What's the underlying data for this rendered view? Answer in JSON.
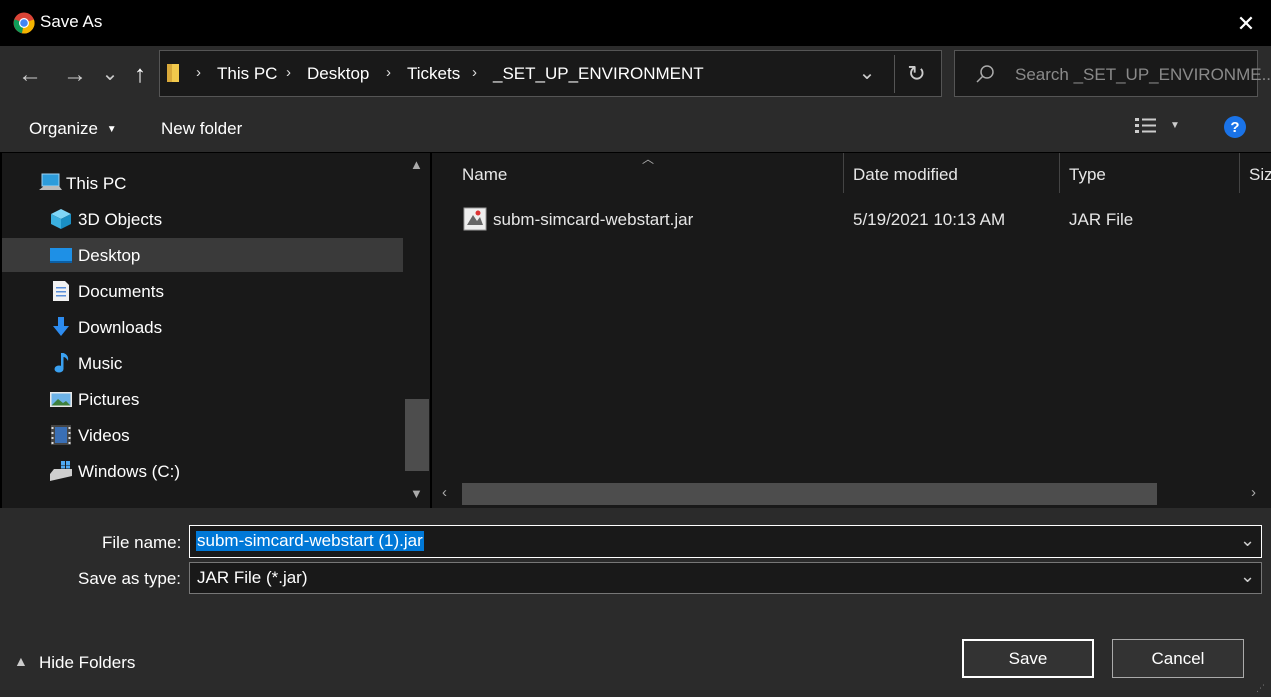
{
  "window": {
    "title": "Save As",
    "close_glyph": "✕"
  },
  "nav": {
    "back_glyph": "←",
    "forward_glyph": "→",
    "recent_glyph": "⌄",
    "up_glyph": "↑",
    "refresh_glyph": "↻",
    "dropdown_glyph": "⌄",
    "separator": "›",
    "breadcrumbs": [
      "This PC",
      "Desktop",
      "Tickets",
      "_SET_UP_ENVIRONMENT"
    ]
  },
  "search": {
    "placeholder": "Search _SET_UP_ENVIRONME..."
  },
  "toolbar": {
    "organize_label": "Organize",
    "new_folder_label": "New folder",
    "help_label": "?"
  },
  "sidebar": {
    "items": [
      {
        "label": "This PC",
        "icon": "computer-icon"
      },
      {
        "label": "3D Objects",
        "icon": "cube-icon"
      },
      {
        "label": "Desktop",
        "icon": "desktop-icon",
        "selected": true
      },
      {
        "label": "Documents",
        "icon": "document-icon"
      },
      {
        "label": "Downloads",
        "icon": "download-icon"
      },
      {
        "label": "Music",
        "icon": "music-icon"
      },
      {
        "label": "Pictures",
        "icon": "picture-icon"
      },
      {
        "label": "Videos",
        "icon": "video-icon"
      },
      {
        "label": "Windows (C:)",
        "icon": "drive-icon"
      }
    ]
  },
  "files": {
    "columns": [
      "Name",
      "Date modified",
      "Type",
      "Siz"
    ],
    "rows": [
      {
        "name": "subm-simcard-webstart.jar",
        "date": "5/19/2021 10:13 AM",
        "type": "JAR File",
        "icon": "jar-file-icon"
      }
    ]
  },
  "form": {
    "file_name_label": "File name:",
    "file_name_value": "subm-simcard-webstart (1).jar",
    "save_type_label": "Save as type:",
    "save_type_value": "JAR File (*.jar)"
  },
  "buttons": {
    "save": "Save",
    "cancel": "Cancel",
    "hide_folders": "Hide Folders"
  },
  "colors": {
    "accent": "#0078d7",
    "background": "#191919",
    "panel": "#2b2b2b"
  }
}
